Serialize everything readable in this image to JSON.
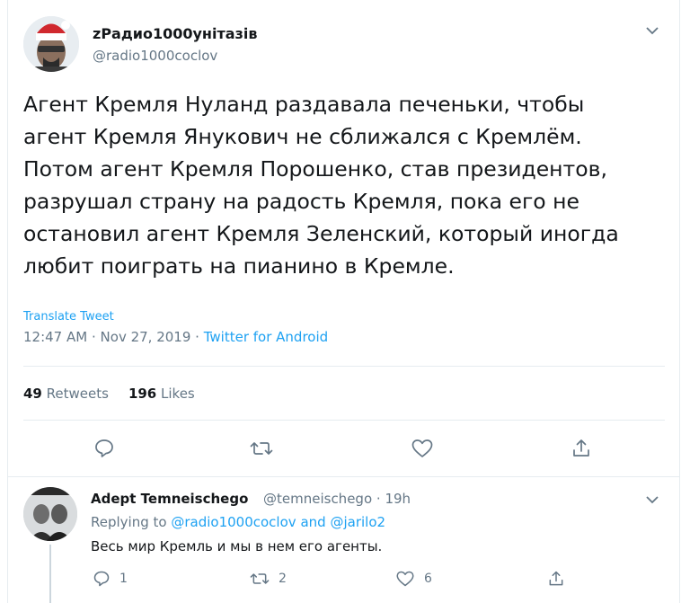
{
  "tweet": {
    "display_name": "zРадио1000унітазів",
    "handle": "@radio1000coclov",
    "text_lines": [
      "Агент Кремля Нуланд раздавала печеньки, чтобы",
      "агент Кремля Янукович не сближался с Кремлём.",
      "Потом агент Кремля Порошенко, став президентов,",
      "разрушал страну на радость Кремля, пока его не",
      "остановил агент Кремля Зеленский, который иногда",
      "любит поиграть на пианино в Кремле."
    ],
    "translate_label": "Translate Tweet",
    "time": "12:47 AM",
    "date": "Nov 27, 2019",
    "separator": "·",
    "source": "Twitter for Android",
    "retweets_count": "49",
    "retweets_label": "Retweets",
    "likes_count": "196",
    "likes_label": "Likes"
  },
  "reply": {
    "display_name": "Adept Temneischego",
    "handle": "@temneischego",
    "separator": "·",
    "time": "19h",
    "replying_prefix": "Replying to",
    "mention_1": "@radio1000coclov",
    "and_word": "and",
    "mention_2": "@jarilo2",
    "text": "Весь мир Кремль и мы в нем его агенты.",
    "reply_count": "1",
    "retweet_count": "2",
    "like_count": "6"
  },
  "icons": {
    "main_chevron": "chevron-down-icon",
    "reply": "reply-icon",
    "retweet": "retweet-icon",
    "like": "heart-icon",
    "share": "share-icon"
  },
  "colors": {
    "accent": "#1da1f2",
    "secondary_text": "#657786",
    "primary_text": "#14171a",
    "divider": "#e6ecf0"
  }
}
